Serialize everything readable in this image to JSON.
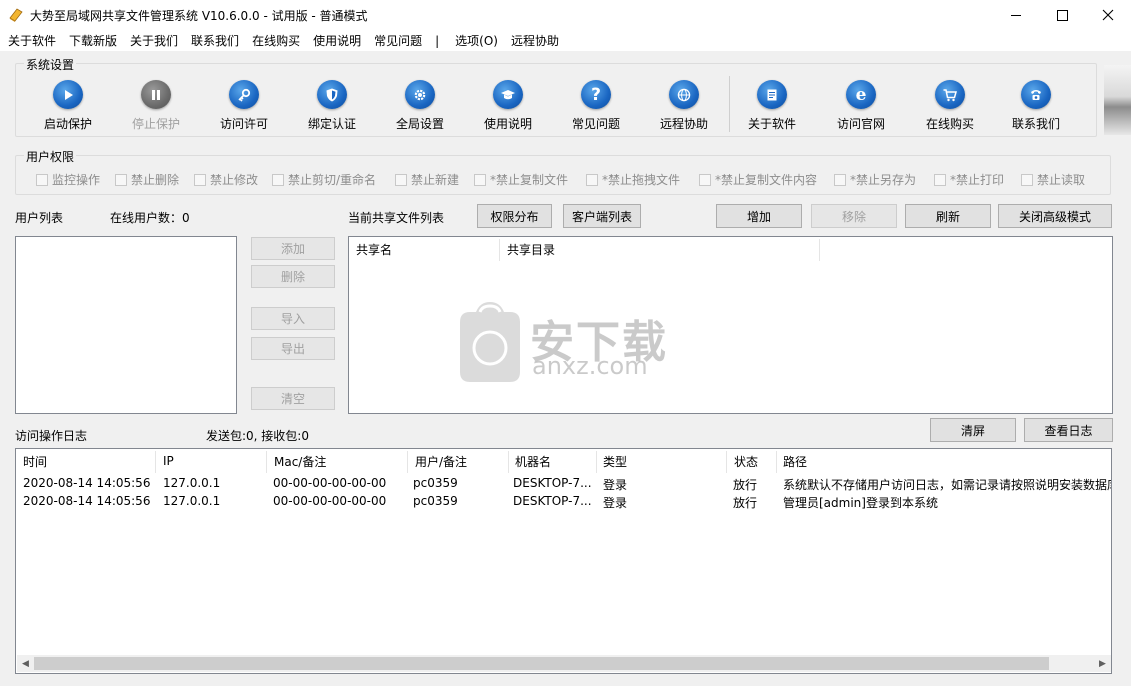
{
  "window": {
    "title": "大势至局域网共享文件管理系统 V10.6.0.0 - 试用版 - 普通模式"
  },
  "menu": {
    "items": [
      "关于软件",
      "下载新版",
      "关于我们",
      "联系我们",
      "在线购买",
      "使用说明",
      "常见问题",
      "|",
      "选项(O)",
      "远程协助"
    ]
  },
  "system_settings": {
    "title": "系统设置",
    "tools": [
      {
        "label": "启动保护",
        "icon": "play-icon",
        "enabled": true
      },
      {
        "label": "停止保护",
        "icon": "pause-icon",
        "enabled": false
      },
      {
        "label": "访问许可",
        "icon": "key-icon",
        "enabled": true
      },
      {
        "label": "绑定认证",
        "icon": "shield-icon",
        "enabled": true
      },
      {
        "label": "全局设置",
        "icon": "gear-icon",
        "enabled": true
      },
      {
        "label": "使用说明",
        "icon": "graduation-cap-icon",
        "enabled": true
      },
      {
        "label": "常见问题",
        "icon": "question-icon",
        "enabled": true
      },
      {
        "label": "远程协助",
        "icon": "globe-icon",
        "enabled": true
      },
      {
        "label": "关于软件",
        "icon": "document-icon",
        "enabled": true
      },
      {
        "label": "访问官网",
        "icon": "ie-icon",
        "enabled": true
      },
      {
        "label": "在线购买",
        "icon": "cart-icon",
        "enabled": true
      },
      {
        "label": "联系我们",
        "icon": "phone-icon",
        "enabled": true
      }
    ]
  },
  "user_permissions": {
    "title": "用户权限",
    "options": [
      "监控操作",
      "禁止删除",
      "禁止修改",
      "禁止剪切/重命名",
      "禁止新建",
      "*禁止复制文件",
      "*禁止拖拽文件",
      "*禁止复制文件内容",
      "*禁止另存为",
      "*禁止打印",
      "禁止读取"
    ]
  },
  "users": {
    "list_label": "用户列表",
    "online_count_label": "在线用户数：0",
    "buttons": {
      "add": "添加",
      "delete": "删除",
      "import": "导入",
      "export": "导出",
      "clear": "清空"
    }
  },
  "shares": {
    "label": "当前共享文件列表",
    "buttons": {
      "perm_dist": "权限分布",
      "client_list": "客户端列表",
      "add": "增加",
      "remove": "移除",
      "refresh": "刷新",
      "close_advanced": "关闭高级模式"
    },
    "columns": [
      "共享名",
      "共享目录"
    ],
    "rows": []
  },
  "log": {
    "label": "访问操作日志",
    "packets": "发送包:0, 接收包:0",
    "buttons": {
      "clear_screen": "清屏",
      "view_log": "查看日志"
    },
    "columns": [
      "时间",
      "IP",
      "Mac/备注",
      "用户/备注",
      "机器名",
      "类型",
      "状态",
      "路径"
    ],
    "rows": [
      {
        "time": "2020-08-14 14:05:56",
        "ip": "127.0.0.1",
        "mac": "00-00-00-00-00-00",
        "user": "pc0359",
        "machine": "DESKTOP-7...",
        "type": "登录",
        "status": "放行",
        "path": "系统默认不存储用户访问日志，如需记录请按照说明安装数据库"
      },
      {
        "time": "2020-08-14 14:05:56",
        "ip": "127.0.0.1",
        "mac": "00-00-00-00-00-00",
        "user": "pc0359",
        "machine": "DESKTOP-7...",
        "type": "登录",
        "status": "放行",
        "path": "管理员[admin]登录到本系统"
      }
    ]
  },
  "watermark": {
    "brand": "安下载",
    "url": "anxz.com"
  },
  "colors": {
    "accent_blue": "#1a66c2",
    "disabled_text": "#a0a0a0",
    "window_bg": "#f0f0f0"
  }
}
